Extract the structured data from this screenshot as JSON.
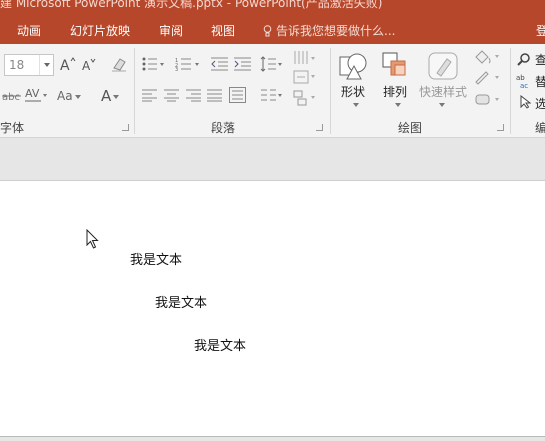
{
  "titlebar": {
    "title": "建 Microsoft PowerPoint 演示文稿.pptx - PowerPoint(产品激活失败)"
  },
  "tabs": {
    "items": [
      "动画",
      "幻灯片放映",
      "审阅",
      "视图"
    ],
    "tell_me": "告诉我您想要做什么...",
    "signin": "登"
  },
  "font_group": {
    "font_size": "18",
    "label": "字体",
    "change_case": "Aa",
    "font_color": "A"
  },
  "paragraph_group": {
    "label": "段落"
  },
  "drawing_group": {
    "label": "绘图",
    "shapes": "形状",
    "arrange": "排列",
    "quick_styles": "快速样式"
  },
  "editing_group": {
    "find": "查",
    "replace": "替",
    "select": "选",
    "label": "编"
  },
  "slide": {
    "texts": [
      "我是文本",
      "我是文本",
      "我是文本"
    ]
  }
}
